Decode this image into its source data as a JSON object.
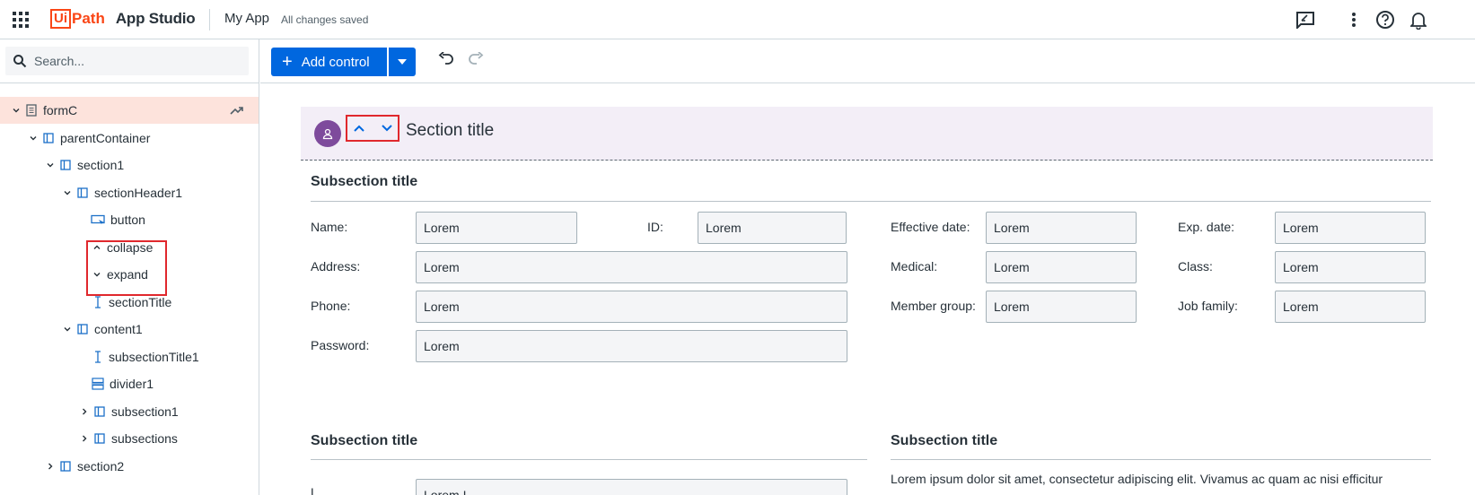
{
  "header": {
    "logo_ui": "Ui",
    "logo_path": "Path",
    "logo_app": "App Studio",
    "app_name": "My App",
    "save_status": "All changes saved",
    "icons": [
      "apps-grid-icon",
      "feedback-icon",
      "more-vert-icon",
      "help-icon",
      "bell-icon"
    ]
  },
  "search": {
    "placeholder": "Search..."
  },
  "tree": {
    "items": [
      {
        "label": "formC",
        "icon": "form-icon",
        "expanded": true,
        "selected": true
      },
      {
        "label": "parentContainer",
        "icon": "container-icon",
        "expanded": true
      },
      {
        "label": "section1",
        "icon": "container-icon",
        "expanded": true
      },
      {
        "label": "sectionHeader1",
        "icon": "container-icon",
        "expanded": true
      },
      {
        "label": "button",
        "icon": "button-icon"
      },
      {
        "label": "collapse",
        "icon": "chevron-up-icon"
      },
      {
        "label": "expand",
        "icon": "chevron-down-icon"
      },
      {
        "label": "sectionTitle",
        "icon": "text-icon"
      },
      {
        "label": "content1",
        "icon": "container-icon",
        "expanded": true
      },
      {
        "label": "subsectionTitle1",
        "icon": "text-icon"
      },
      {
        "label": "divider1",
        "icon": "divider-icon"
      },
      {
        "label": "subsection1",
        "icon": "container-icon",
        "expanded": false
      },
      {
        "label": "subsections",
        "icon": "container-icon",
        "expanded": false
      },
      {
        "label": "section2",
        "icon": "container-icon",
        "expanded": false
      }
    ]
  },
  "toolbar": {
    "add_control_label": "Add control"
  },
  "canvas": {
    "section_title": "Section title",
    "subsection1": {
      "title": "Subsection title",
      "fields": {
        "name_label": "Name:",
        "name_value": "Lorem",
        "id_label": "ID:",
        "id_value": "Lorem",
        "effective_label": "Effective date:",
        "effective_value": "Lorem",
        "exp_label": "Exp. date:",
        "exp_value": "Lorem",
        "address_label": "Address:",
        "address_value": "Lorem",
        "medical_label": "Medical:",
        "medical_value": "Lorem",
        "class_label": "Class:",
        "class_value": "Lorem",
        "phone_label": "Phone:",
        "phone_value": "Lorem",
        "member_label": "Member group:",
        "member_value": "Lorem",
        "job_label": "Job family:",
        "job_value": "Lorem",
        "password_label": "Password:",
        "password_value": "Lorem"
      }
    },
    "subsection2": {
      "title": "Subsection title",
      "first_label": "L",
      "first_value": "Lorem I"
    },
    "subsection3": {
      "title": "Subsection title",
      "body": "Lorem ipsum dolor sit amet, consectetur adipiscing elit. Vivamus ac quam ac nisi efficitur"
    }
  },
  "colors": {
    "accent": "#0067df",
    "brand": "#fa4616",
    "selected_row": "#fde3dc",
    "section_header_bg": "#f3eef7",
    "highlight": "#e0282d"
  }
}
